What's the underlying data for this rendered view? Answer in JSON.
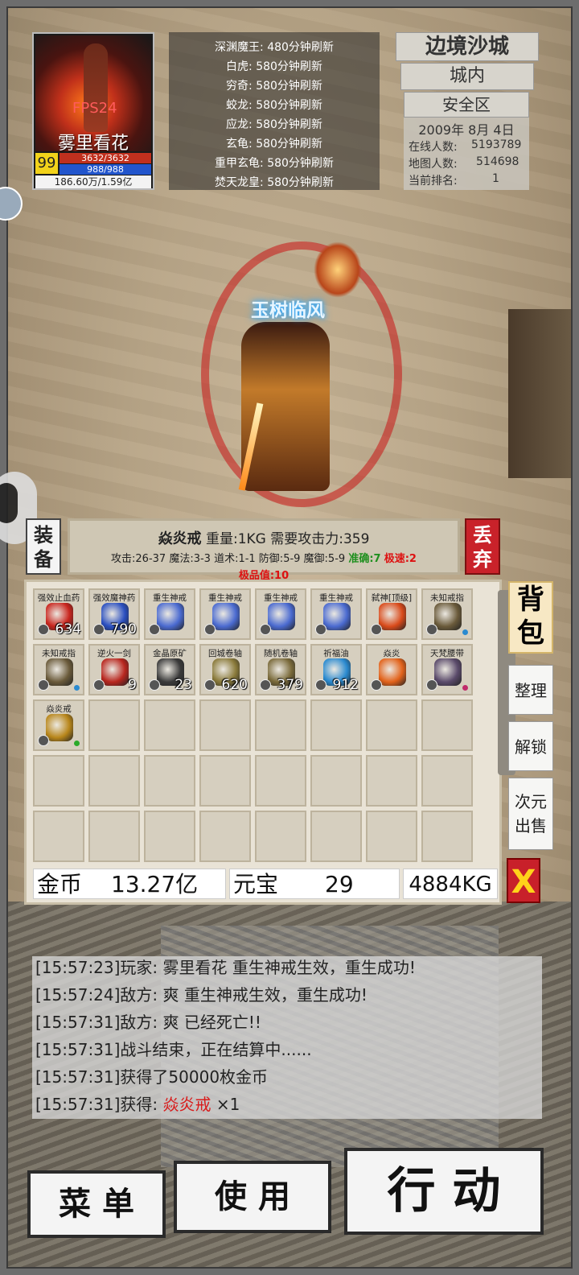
{
  "player": {
    "fps": "FPS24",
    "name": "雾里看花",
    "level": "99",
    "hp": "3632/3632",
    "mp": "988/988",
    "exp": "186.60万/1.59亿"
  },
  "boss_list": [
    "深渊魔王: 480分钟刷新",
    "白虎: 580分钟刷新",
    "穷奇: 580分钟刷新",
    "蛟龙: 580分钟刷新",
    "应龙: 580分钟刷新",
    "玄龟: 580分钟刷新",
    "重甲玄龟: 580分钟刷新",
    "焚天龙皇: 580分钟刷新"
  ],
  "zone": {
    "map": "边境沙城",
    "area": "城内",
    "safety": "安全区",
    "date": "2009年 8月 4日",
    "online_label": "在线人数:",
    "online": "5193789",
    "map_players_label": "地图人数:",
    "map_players": "514698",
    "rank_label": "当前排名:",
    "rank": "1"
  },
  "character_name": "玉树临风",
  "item_info": {
    "equip_label_1": "装",
    "equip_label_2": "备",
    "drop_label_1": "丢",
    "drop_label_2": "弃",
    "name": "焱炎戒",
    "weight": "重量:1KG",
    "requirement": "需要攻击力:359",
    "stats": "攻击:26-37 魔法:3-3 道术:1-1 防御:5-9 魔御:5-9",
    "accuracy": "准确:7",
    "speed": "极速:2",
    "quality": "极品值:10"
  },
  "bag": {
    "items": [
      {
        "name": "强效止血药",
        "count": "634",
        "color": "#c9251e"
      },
      {
        "name": "强效魔神药",
        "count": "790",
        "color": "#2a4fc0"
      },
      {
        "name": "重生神戒",
        "count": "",
        "color": "#4a6ad0"
      },
      {
        "name": "重生神戒",
        "count": "",
        "color": "#4a6ad0"
      },
      {
        "name": "重生神戒",
        "count": "",
        "color": "#4a6ad0"
      },
      {
        "name": "重生神戒",
        "count": "",
        "color": "#4a6ad0"
      },
      {
        "name": "弑神[顶级]",
        "count": "",
        "color": "#d94a1a"
      },
      {
        "name": "未知戒指",
        "count": "",
        "color": "#6a5a3a"
      },
      {
        "name": "未知戒指",
        "count": "",
        "color": "#6a5a3a"
      },
      {
        "name": "逆火一剑",
        "count": "9",
        "color": "#b8261e"
      },
      {
        "name": "金晶原矿",
        "count": "23",
        "color": "#3a3a3a"
      },
      {
        "name": "回城卷轴",
        "count": "620",
        "color": "#8a7a3a"
      },
      {
        "name": "随机卷轴",
        "count": "379",
        "color": "#7a6a3a"
      },
      {
        "name": "祈福油",
        "count": "912",
        "color": "#2a8ad0"
      },
      {
        "name": "焱炎",
        "count": "",
        "color": "#e2621a"
      },
      {
        "name": "天梵腰带",
        "count": "",
        "color": "#5a4a6a"
      },
      {
        "name": "焱炎戒",
        "count": "",
        "color": "#b8861a"
      }
    ],
    "gold_label": "金币",
    "gold": "13.27亿",
    "yuanbao_label": "元宝",
    "yuanbao": "29",
    "weight": "4884KG"
  },
  "side_buttons": {
    "bag_tab_1": "背",
    "bag_tab_2": "包",
    "sort": "整理",
    "unlock": "解锁",
    "sell_1": "次元",
    "sell_2": "出售",
    "close": "X"
  },
  "log": [
    {
      "text": "[15:57:23]玩家: 雾里看花 重生神戒生效，重生成功!",
      "highlight": "",
      "suffix": ""
    },
    {
      "text": "[15:57:24]敌方: 爽 重生神戒生效，重生成功!",
      "highlight": "",
      "suffix": ""
    },
    {
      "text": "[15:57:31]敌方: 爽 已经死亡!!",
      "highlight": "",
      "suffix": ""
    },
    {
      "text": "[15:57:31]战斗结束，正在结算中......",
      "highlight": "",
      "suffix": ""
    },
    {
      "text": "[15:57:31]获得了50000枚金币",
      "highlight": "",
      "suffix": ""
    },
    {
      "text": "[15:57:31]获得: ",
      "highlight": "焱炎戒",
      "suffix": " ×1"
    }
  ],
  "bottom": {
    "menu": "菜 单",
    "use": "使 用",
    "action": "行 动"
  }
}
